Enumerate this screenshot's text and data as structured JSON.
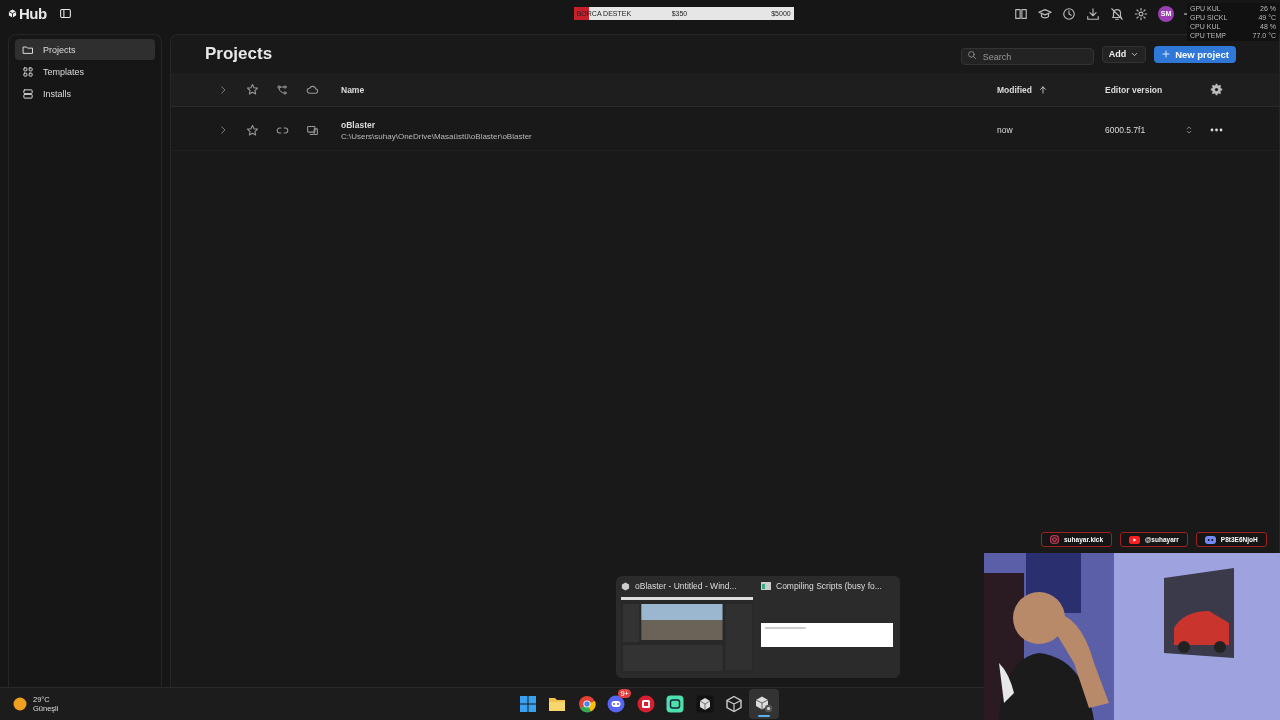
{
  "top_bar": {
    "title": "Hub",
    "donation": {
      "label": "BORCA DESTEK",
      "current": "$350",
      "goal": "$5000",
      "level": 0.07
    },
    "avatar": "SM"
  },
  "system_monitor": [
    {
      "label": "GPU KUL",
      "value": "26 %"
    },
    {
      "label": "GPU SICKL",
      "value": "49 °C"
    },
    {
      "label": "CPU KUL",
      "value": "48 %"
    },
    {
      "label": "CPU TEMP",
      "value": "77.0 °C"
    }
  ],
  "sidebar": {
    "items": [
      {
        "kind": "folder",
        "label": "Projects",
        "selected": true
      },
      {
        "kind": "grid",
        "label": "Templates",
        "selected": false
      },
      {
        "kind": "stack",
        "label": "Installs",
        "selected": false
      }
    ]
  },
  "page": {
    "title": "Projects",
    "search": {
      "placeholder": "Search"
    },
    "add_button": "Add",
    "new_button": "New project"
  },
  "table": {
    "columns": [
      {
        "label": "Name",
        "sorted_ascending": false
      },
      {
        "label": "Modified",
        "sorted_ascending": true
      },
      {
        "label": "Editor version",
        "sorted_ascending": false
      }
    ],
    "rows": [
      {
        "name": "oBlaster",
        "path": "C:\\Users\\suhay\\OneDrive\\Masaüstü\\oBlaster\\oBlaster",
        "modified": "now",
        "editor_version": "6000.5.7f1"
      }
    ]
  },
  "social": [
    {
      "kind": "kick",
      "label": "suhayar.kick"
    },
    {
      "kind": "youtube",
      "label": "@suhayarr"
    },
    {
      "kind": "discord",
      "label": "P8t3E6NjoH"
    }
  ],
  "task_preview": [
    {
      "kind": "editor",
      "title": "oBlaster - Untitled - Wind..."
    },
    {
      "kind": "dialog",
      "title": "Compiling Scripts (busy fo..."
    }
  ],
  "taskbar": {
    "weather": {
      "temp": "29°C",
      "condition": "Güneşli"
    },
    "apps": [
      {
        "kind": "windows",
        "selected": false
      },
      {
        "kind": "folder",
        "selected": false
      },
      {
        "kind": "chrome",
        "selected": false
      },
      {
        "kind": "discord",
        "badge": "9+",
        "selected": false
      },
      {
        "kind": "red",
        "selected": false
      },
      {
        "kind": "green",
        "selected": false
      },
      {
        "kind": "cube",
        "selected": false
      },
      {
        "kind": "unity",
        "selected": false
      },
      {
        "kind": "hub",
        "selected": true
      }
    ]
  }
}
